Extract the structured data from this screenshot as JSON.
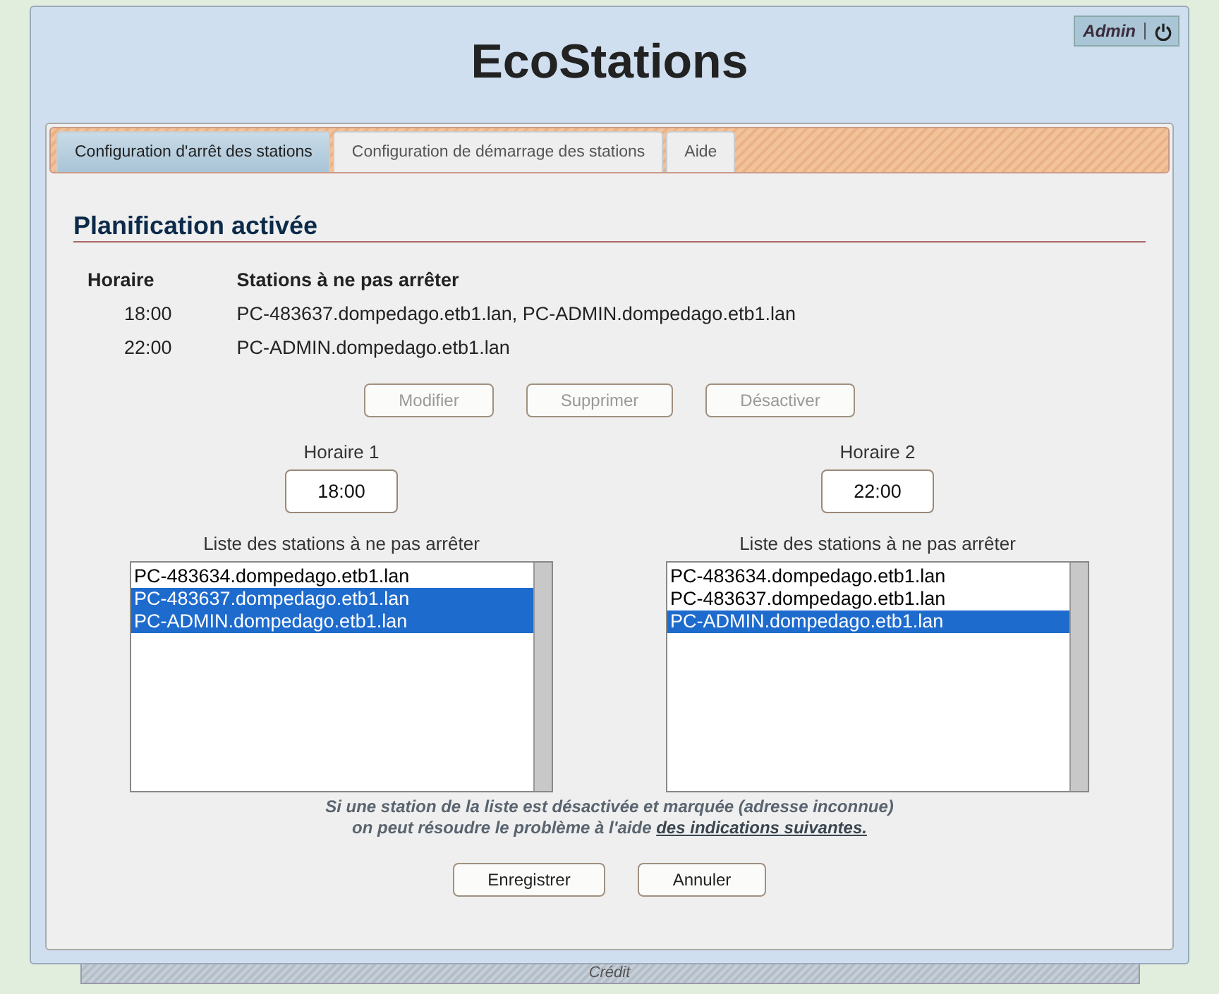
{
  "header": {
    "title": "EcoStations",
    "user": "Admin"
  },
  "tabs": [
    {
      "label": "Configuration d'arrêt des stations",
      "selected": true
    },
    {
      "label": "Configuration de démarrage des stations",
      "selected": false
    },
    {
      "label": "Aide",
      "selected": false
    }
  ],
  "section_title": "Planification activée",
  "schedule_table": {
    "columns": [
      "Horaire",
      "Stations à ne pas arrêter"
    ],
    "rows": [
      [
        "18:00",
        "PC-483637.dompedago.etb1.lan, PC-ADMIN.dompedago.etb1.lan"
      ],
      [
        "22:00",
        "PC-ADMIN.dompedago.etb1.lan"
      ]
    ]
  },
  "actions": [
    {
      "label": "Modifier",
      "disabled": true
    },
    {
      "label": "Supprimer",
      "disabled": true
    },
    {
      "label": "Désactiver",
      "disabled": true
    }
  ],
  "schedules": [
    {
      "time_label": "Horaire 1",
      "time": "18:00",
      "list_label": "Liste des stations à ne pas arrêter",
      "stations": [
        {
          "name": "PC-483634.dompedago.etb1.lan",
          "selected": false
        },
        {
          "name": "PC-483637.dompedago.etb1.lan",
          "selected": true
        },
        {
          "name": "PC-ADMIN.dompedago.etb1.lan",
          "selected": true
        }
      ]
    },
    {
      "time_label": "Horaire 2",
      "time": "22:00",
      "list_label": "Liste des stations à ne pas arrêter",
      "stations": [
        {
          "name": "PC-483634.dompedago.etb1.lan",
          "selected": false
        },
        {
          "name": "PC-483637.dompedago.etb1.lan",
          "selected": false
        },
        {
          "name": "PC-ADMIN.dompedago.etb1.lan",
          "selected": true
        }
      ]
    }
  ],
  "note": {
    "line_1": "Si une station de la liste est désactivée et marquée (adresse inconnue)",
    "line_2": "on peut résoudre le problème à l'aide",
    "link": "des indications suivantes."
  },
  "form_buttons": [
    "Enregistrer",
    "Annuler"
  ],
  "footer": "Crédit"
}
